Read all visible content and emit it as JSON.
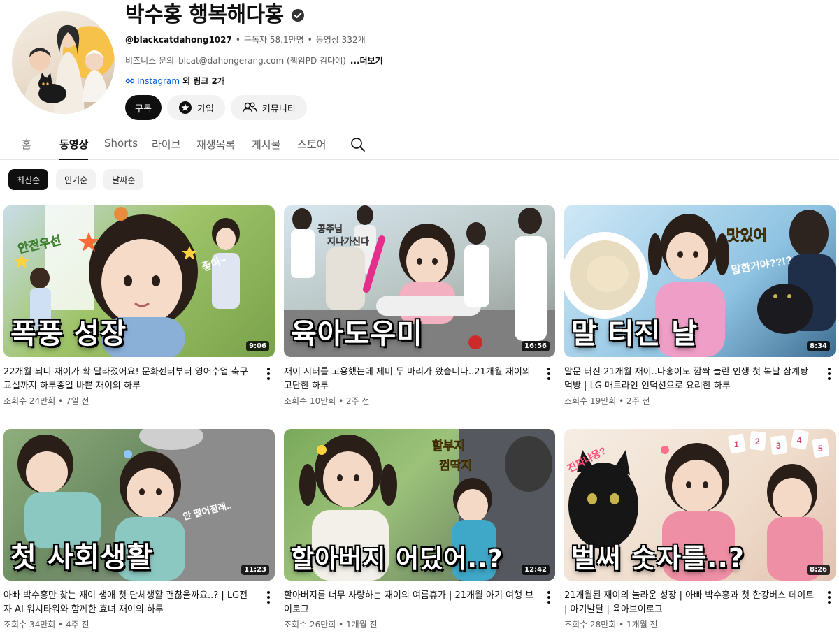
{
  "channel": {
    "name": "박수홍 행복해다홍",
    "handle": "@blackcatdahong1027",
    "sep": "•",
    "subscribers": "구독자 58.1만명",
    "video_count": "동영상 332개",
    "desc_prefix": "비즈니스 문의",
    "desc_email": "blcat@dahongerang.com (책임PD 김다예)",
    "desc_more": "...더보기",
    "link_label": "Instagram",
    "link_rest": "외 링크 2개"
  },
  "buttons": {
    "subscribe": "구독",
    "join": "가입",
    "community": "커뮤니티"
  },
  "tabs": [
    "홈",
    "동영상",
    "Shorts",
    "라이브",
    "재생목록",
    "게시물",
    "스토어"
  ],
  "chips": [
    "최신순",
    "인기순",
    "날짜순"
  ],
  "videos": [
    {
      "overlay": "폭풍 성장",
      "duration": "9:06",
      "title": "22개월 되니 재이가 확 달라졌어요! 문화센터부터 영어수업 축구교실까지 하루종일 바쁜 재이의 하루",
      "views": "조회수 24만회",
      "age": "7일 전"
    },
    {
      "overlay": "육아도우미",
      "duration": "16:56",
      "title": "재이 시터를 고용했는데 제비 두 마리가 왔습니다..21개월 재이의 고단한 하루",
      "views": "조회수 10만회",
      "age": "2주 전"
    },
    {
      "overlay": "말 터진 날",
      "duration": "8:34",
      "title": "말문 터진 21개월 재이..다홍이도 깜짝 놀란 인생 첫 복날 삼계탕 먹방 | LG 매트라인 인덕션으로 요리한 하루",
      "views": "조회수 19만회",
      "age": "2주 전"
    },
    {
      "overlay": "첫 사회생활",
      "duration": "11:23",
      "title": "아빠 박수홍만 찾는 재이 생애 첫 단체생활 괜찮을까요..? | LG전자 AI 워시타워와 함께한 효녀 재이의 하루",
      "views": "조회수 34만회",
      "age": "4주 전"
    },
    {
      "overlay": "할아버지 어딨어..?",
      "duration": "12:42",
      "title": "할아버지를 너무 사랑하는 재이의 여름휴가 | 21개월 아기 여행 브이로그",
      "views": "조회수 26만회",
      "age": "1개월 전"
    },
    {
      "overlay": "벌써 숫자를..?",
      "duration": "8:26",
      "title": "21개월된 재이의 놀라운 성장 | 아빠 박수홍과 첫 한강버스 데이트 | 아기발달 | 육아브이로그",
      "views": "조회수 28만회",
      "age": "1개월 전"
    }
  ],
  "thumb_texts": {
    "v1": [
      "안전우선",
      "좋아~"
    ],
    "v2": [
      "공주님",
      "지나가신다"
    ],
    "v3": [
      "맛있어",
      "말한거야??!?"
    ],
    "v4": [
      "안 떨어질래.."
    ],
    "v5": [
      "할부지",
      "껌딱지"
    ],
    "v6": [
      "진짜냐옹?",
      "1",
      "2",
      "3",
      "4",
      "5"
    ]
  },
  "colors": {
    "accent": "#0f0f0f",
    "link": "#065fd4",
    "muted": "#606060",
    "chip_bg": "#f2f2f2"
  }
}
